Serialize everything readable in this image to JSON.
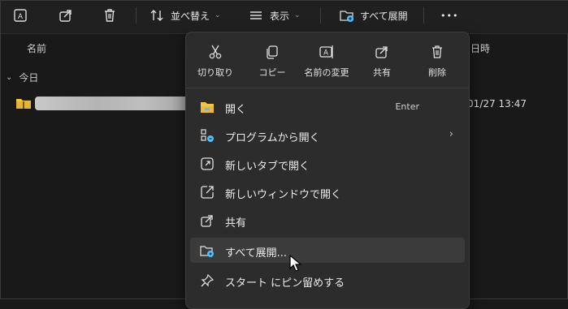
{
  "toolbar": {
    "sort_label": "並べ替え",
    "view_label": "表示",
    "extract_all_label": "すべて展開",
    "more_label": "•••"
  },
  "columns": {
    "name": "名前",
    "date": "日時"
  },
  "group": {
    "label": "今日"
  },
  "file": {
    "date": "/01/27 13:47"
  },
  "context_menu": {
    "quick_actions": [
      {
        "label": "切り取り",
        "icon": "scissors-icon"
      },
      {
        "label": "コピー",
        "icon": "copy-icon"
      },
      {
        "label": "名前の変更",
        "icon": "rename-icon"
      },
      {
        "label": "共有",
        "icon": "share-icon"
      },
      {
        "label": "削除",
        "icon": "trash-icon"
      }
    ],
    "items": [
      {
        "label": "開く",
        "shortcut": "Enter",
        "icon": "folder-open-icon"
      },
      {
        "label": "プログラムから開く",
        "arrow": "›",
        "icon": "open-with-icon"
      },
      {
        "label": "新しいタブで開く",
        "icon": "new-tab-icon"
      },
      {
        "label": "新しいウィンドウで開く",
        "icon": "new-window-icon"
      },
      {
        "label": "共有",
        "icon": "share-icon"
      },
      {
        "label": "すべて展開...",
        "icon": "extract-icon",
        "highlighted": true
      },
      {
        "label": "スタート にピン留めする",
        "icon": "pin-icon"
      }
    ]
  },
  "colors": {
    "background": "#191919",
    "menu": "#2c2c2c",
    "highlight": "#3b3b3b",
    "accent": "#4cc2ff",
    "folder": "#f4c542"
  }
}
